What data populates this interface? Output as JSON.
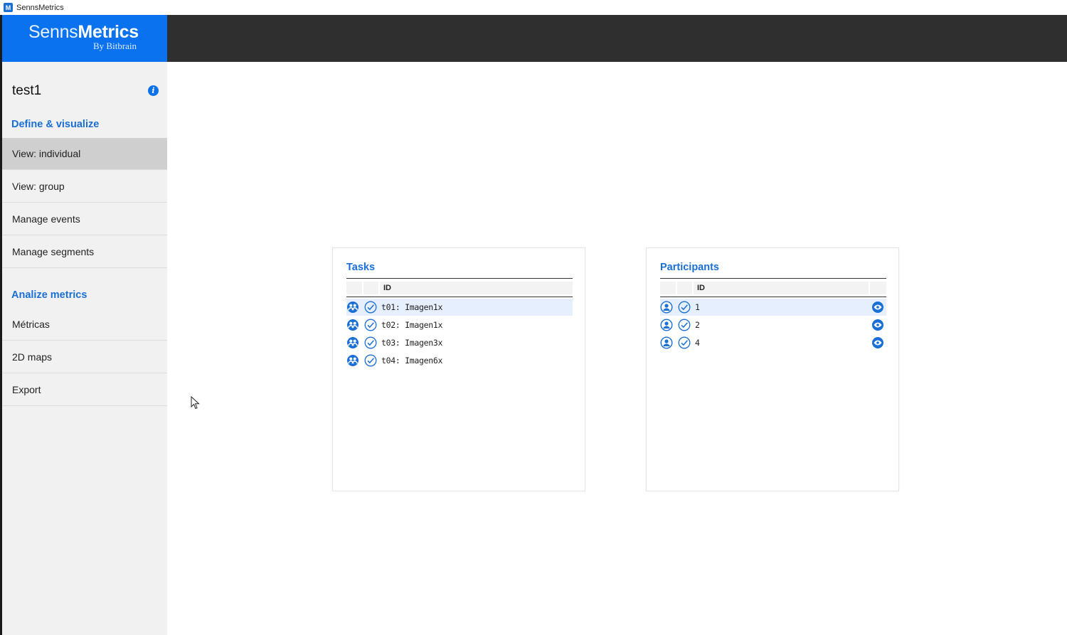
{
  "window": {
    "title": "SennsMetrics",
    "icon": "app-icon"
  },
  "header": {
    "logo_light": "Senns",
    "logo_bold": "Metrics",
    "logo_sub": "By Bitbrain",
    "colors": {
      "brand": "#0b72ef",
      "topbar": "#2f2f2f"
    }
  },
  "sidebar": {
    "project_name": "test1",
    "info_icon": "i",
    "section_define": "Define & visualize",
    "define_items": [
      {
        "label": "View: individual",
        "active": true
      },
      {
        "label": "View: group"
      },
      {
        "label": "Manage events"
      },
      {
        "label": "Manage segments"
      }
    ],
    "section_analyze": "Analize metrics",
    "analyze_items": [
      {
        "label": "Métricas"
      },
      {
        "label": "2D maps"
      },
      {
        "label": "Export"
      }
    ]
  },
  "tasks": {
    "title": "Tasks",
    "column_id": "ID",
    "rows": [
      {
        "label": "t01: Imagen1x",
        "selected": true
      },
      {
        "label": "t02: Imagen1x"
      },
      {
        "label": "t03: Imagen3x"
      },
      {
        "label": "t04: Imagen6x"
      }
    ]
  },
  "participants": {
    "title": "Participants",
    "column_id": "ID",
    "rows": [
      {
        "label": "1",
        "selected": true
      },
      {
        "label": "2"
      },
      {
        "label": "4"
      }
    ]
  }
}
